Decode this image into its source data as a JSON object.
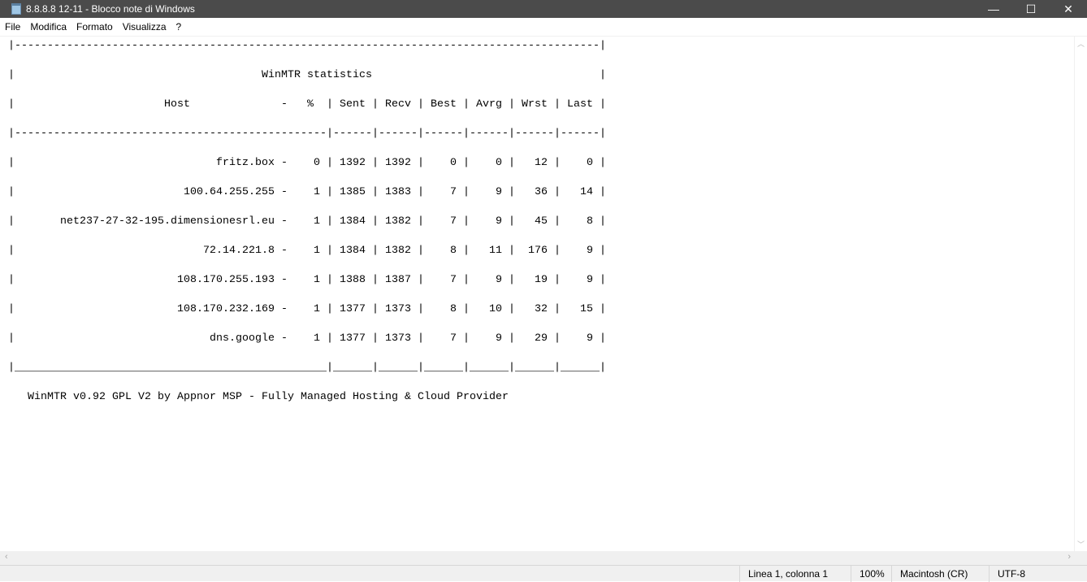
{
  "window": {
    "title": "8.8.8.8 12-11 - Blocco note di Windows",
    "minimize": "—",
    "maximize": "☐",
    "close": "✕"
  },
  "menu": [
    "File",
    "Modifica",
    "Formato",
    "Visualizza",
    "?"
  ],
  "report": {
    "title": "WinMTR statistics",
    "columns": {
      "host": "Host",
      "loss": "%",
      "others": [
        "Sent",
        "Recv",
        "Best",
        "Avrg",
        "Wrst",
        "Last"
      ]
    },
    "rows": [
      {
        "host": "fritz.box",
        "loss": "0",
        "values": [
          "1392",
          "1392",
          "0",
          "0",
          "12",
          "0"
        ]
      },
      {
        "host": "100.64.255.255",
        "loss": "1",
        "values": [
          "1385",
          "1383",
          "7",
          "9",
          "36",
          "14"
        ]
      },
      {
        "host": "net237-27-32-195.dimensionesrl.eu",
        "loss": "1",
        "values": [
          "1384",
          "1382",
          "7",
          "9",
          "45",
          "8"
        ]
      },
      {
        "host": "72.14.221.8",
        "loss": "1",
        "values": [
          "1384",
          "1382",
          "8",
          "11",
          "176",
          "9"
        ]
      },
      {
        "host": "108.170.255.193",
        "loss": "1",
        "values": [
          "1388",
          "1387",
          "7",
          "9",
          "19",
          "9"
        ]
      },
      {
        "host": "108.170.232.169",
        "loss": "1",
        "values": [
          "1377",
          "1373",
          "8",
          "10",
          "32",
          "15"
        ]
      },
      {
        "host": "dns.google",
        "loss": "1",
        "values": [
          "1377",
          "1373",
          "7",
          "9",
          "29",
          "9"
        ]
      }
    ],
    "footer": "WinMTR v0.92 GPL V2 by Appnor MSP - Fully Managed Hosting & Cloud Provider"
  },
  "status": {
    "position": "Linea 1, colonna 1",
    "zoom": "100%",
    "line_ending": "Macintosh (CR)",
    "encoding": "UTF-8"
  }
}
